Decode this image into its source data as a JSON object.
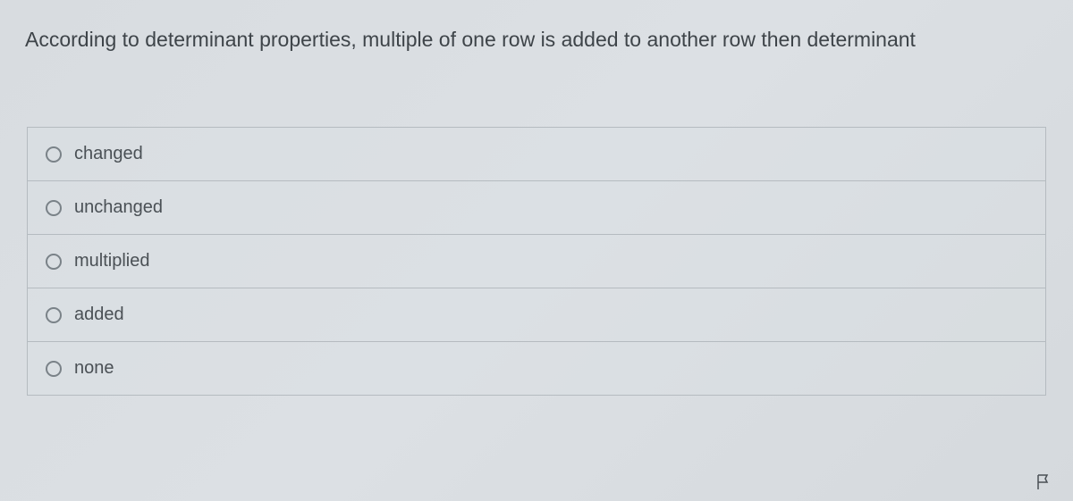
{
  "question": {
    "text": "According to determinant properties, multiple of one row is added to another row then determinant"
  },
  "options": [
    {
      "label": "changed"
    },
    {
      "label": "unchanged"
    },
    {
      "label": "multiplied"
    },
    {
      "label": "added"
    },
    {
      "label": "none"
    }
  ]
}
